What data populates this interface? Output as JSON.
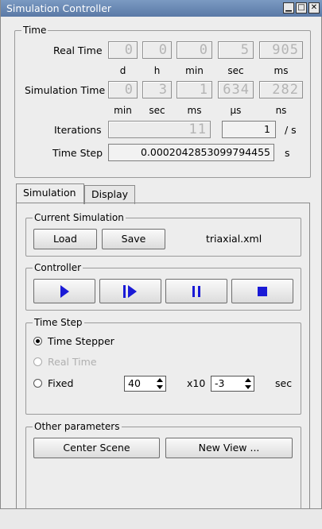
{
  "window": {
    "title": "Simulation Controller"
  },
  "time_group": {
    "label": "Time",
    "real_time": {
      "label": "Real Time",
      "d": "0",
      "h": "0",
      "min": "0",
      "sec": "5",
      "ms": "905",
      "units": [
        "d",
        "h",
        "min",
        "sec",
        "ms"
      ]
    },
    "sim_time": {
      "label": "Simulation Time",
      "min": "0",
      "sec": "3",
      "ms": "1",
      "us": "634",
      "ns": "282",
      "units": [
        "min",
        "sec",
        "ms",
        "µs",
        "ns"
      ]
    },
    "iterations": {
      "label": "Iterations",
      "count": "11",
      "rate": "1",
      "rate_unit": "/ s"
    },
    "time_step": {
      "label": "Time Step",
      "value": "0.0002042853099794455",
      "unit": "s"
    }
  },
  "tabs": [
    {
      "label": "Simulation"
    },
    {
      "label": "Display"
    }
  ],
  "current_simulation": {
    "label": "Current Simulation",
    "load": "Load",
    "save": "Save",
    "file": "triaxial.xml"
  },
  "controller": {
    "label": "Controller",
    "buttons": [
      "play-icon",
      "step-icon",
      "pause-icon",
      "stop-icon"
    ],
    "icon_color": "#1a1ad6"
  },
  "time_step_group": {
    "label": "Time Step",
    "options": [
      {
        "label": "Time Stepper",
        "selected": true
      },
      {
        "label": "Real Time",
        "disabled": true
      },
      {
        "label": "Fixed"
      }
    ],
    "fixed_value": "40",
    "multiplier": "x10",
    "exponent": "-3",
    "unit": "sec"
  },
  "other_params": {
    "label": "Other parameters",
    "center_scene": "Center Scene",
    "new_view": "New View ..."
  }
}
